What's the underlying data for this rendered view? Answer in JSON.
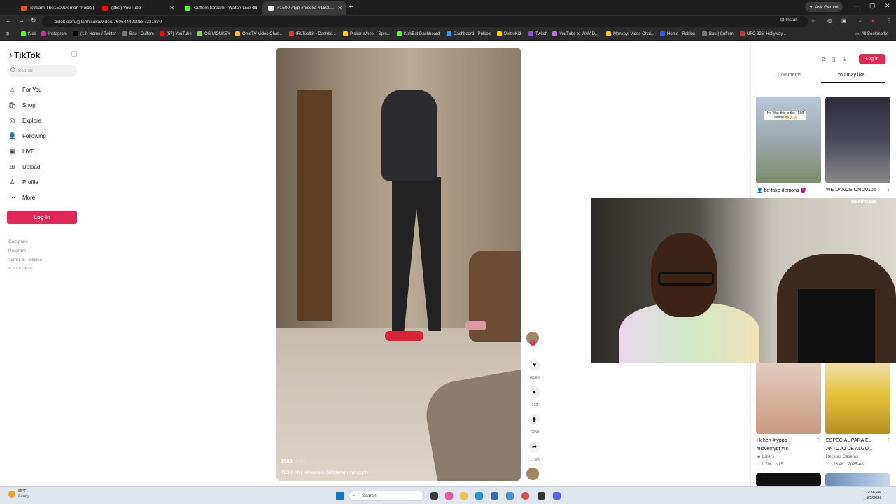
{
  "browser": {
    "tabs": [
      {
        "title": "Stream The1500Demon music |",
        "color": "#f04e23"
      },
      {
        "title": "(950) YouTube",
        "color": "#ff0000"
      },
      {
        "title": "Cuffem Stream - Watch Live on",
        "color": "#53fc18"
      },
      {
        "title": "#1500 #fyp #hisoka #1500...",
        "color": "#ffffff"
      }
    ],
    "ask_gemini": "Ask Gemini",
    "url": "tiktok.com/@lahhisoka/video/7606444290587331870",
    "install": "Install",
    "all_bookmarks": "All Bookmarks",
    "bookmarks": [
      "Kick",
      "Instagram",
      "(12) Home / Twitter",
      "Bau | Cuffem",
      "(57) YouTube",
      "OG MONKEY",
      "OmeTV Video Chat...",
      "IRLToolkit • Dashbo...",
      "Picker Wheel - Spin...",
      "KickBot Dashboard",
      "Dashboard - Pulsoid",
      "DistroKid",
      "Twitch",
      "YouTube to WAV D...",
      "Monkey: Video Chat...",
      "Home - Roblox",
      "Bau | Cuffem",
      "UFC 326: Hollyway..."
    ]
  },
  "tiktok": {
    "logo": "TikTok",
    "search_placeholder": "Search",
    "nav": [
      {
        "label": "For You",
        "icon": "⌂"
      },
      {
        "label": "Shop",
        "icon": "🛍"
      },
      {
        "label": "Explore",
        "icon": "◎"
      },
      {
        "label": "Following",
        "icon": "👤"
      },
      {
        "label": "LIVE",
        "icon": "▣"
      },
      {
        "label": "Upload",
        "icon": "⊞"
      },
      {
        "label": "Profile",
        "icon": "♙"
      },
      {
        "label": "More",
        "icon": "⋯"
      }
    ],
    "login": "Log in",
    "footer": [
      "Company",
      "Program",
      "Terms & Policies"
    ],
    "copyright": "© 2026 TikTok"
  },
  "video": {
    "author": "1500",
    "date": "2-13",
    "caption": "#1500 #fyp #hisoka #1500demon #pluggnb",
    "likes": "43.6K",
    "comments": "732",
    "saves": "6250",
    "shares": "17.9K"
  },
  "right_panel": {
    "login": "Log in",
    "tabs": [
      "Comments",
      "You may like"
    ],
    "items": [
      {
        "title": "👤 be fake demons 😈",
        "overlay": "No Way this is the 1500 Demon 😂🙏🙏"
      },
      {
        "title": "WE DANCE ON 2010s"
      },
      {
        "title": "Heheh #fyppp",
        "sub": "#ilovemybf #rs",
        "author": "Lilliers",
        "stats": "1.7M · 2-15"
      },
      {
        "title": "ESPECIAL PARA EL",
        "sub": "ANTOJO DE ALGO...",
        "author": "Recetas Caseras",
        "stats": "126.4K · 2025-4-9"
      }
    ]
  },
  "stream_overlay": {
    "logo": "weedmaps"
  },
  "taskbar": {
    "temp": "85°F",
    "weather": "Sunny",
    "search": "Search",
    "time": "2:38 PM",
    "date": "8/2/2026"
  }
}
